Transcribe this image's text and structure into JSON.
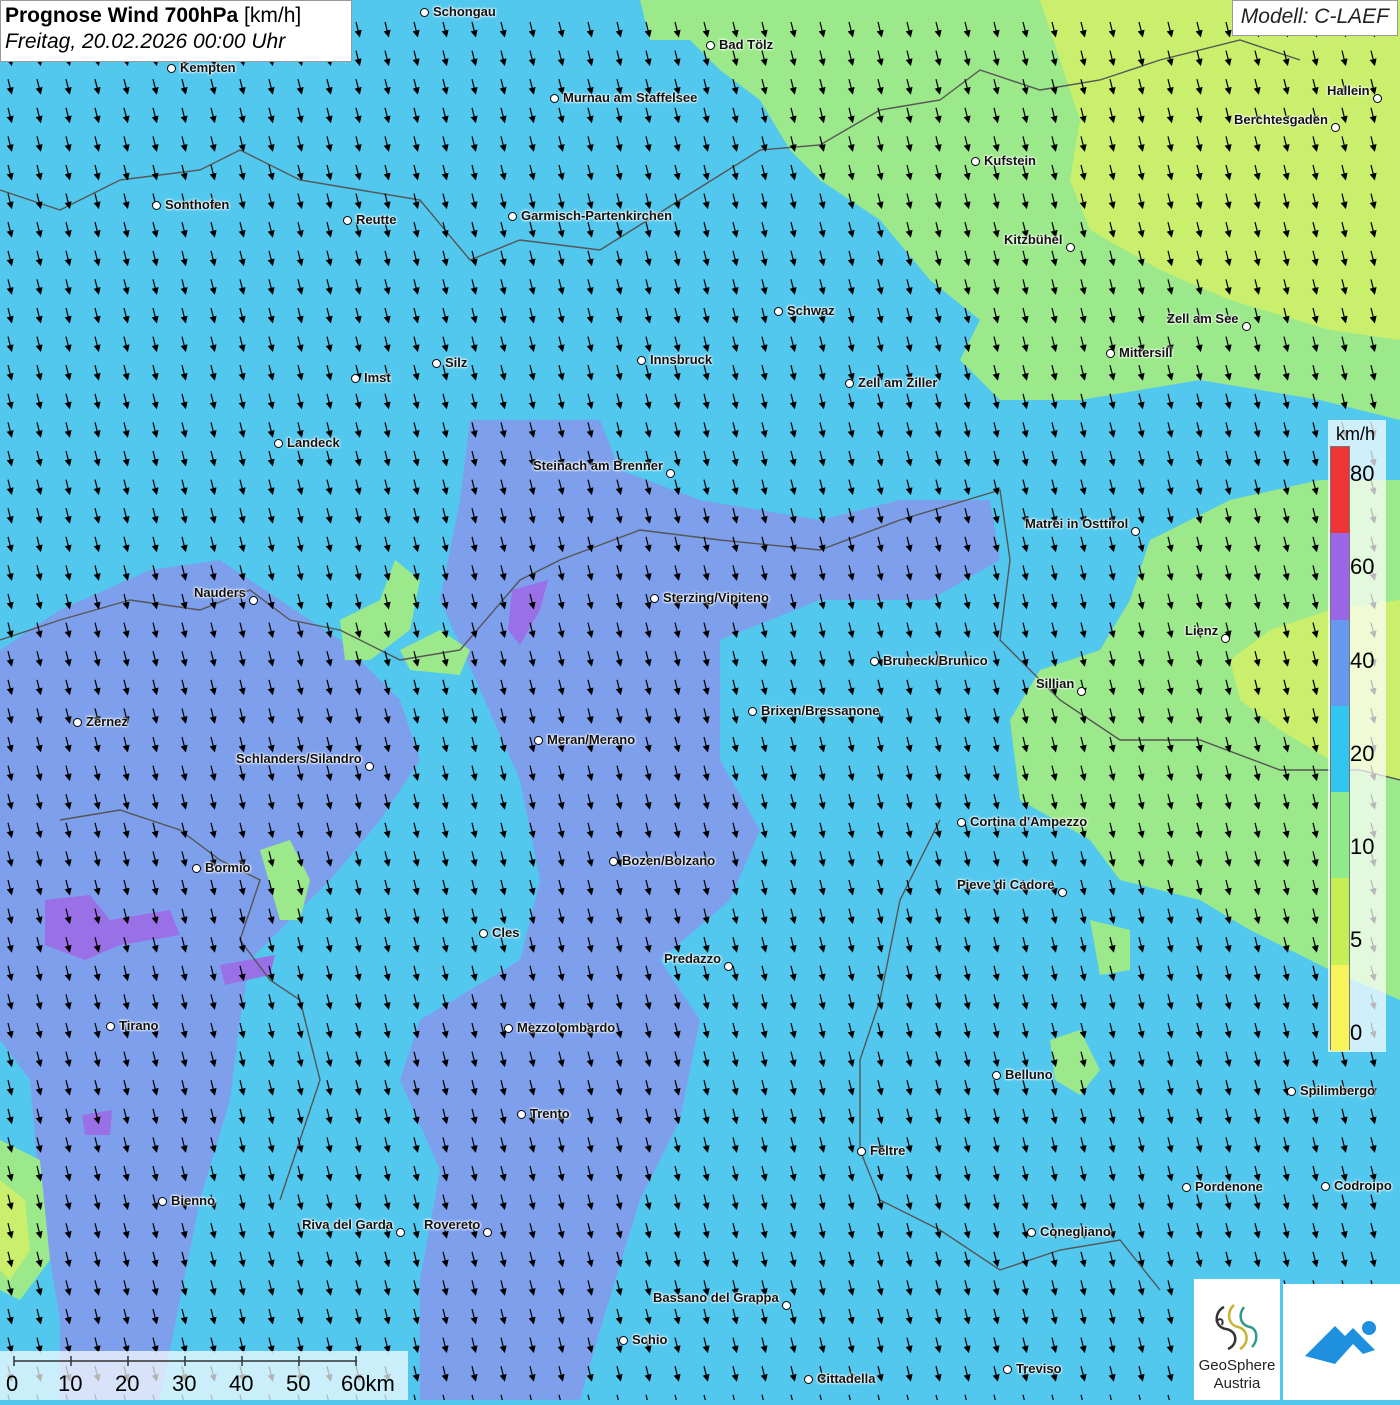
{
  "header": {
    "title_bold": "Prognose Wind 700hPa",
    "title_unit": " [km/h]",
    "datetime": "Freitag, 20.02.2026 00:00 Uhr",
    "model": "Modell: C-LAEF"
  },
  "legend": {
    "unit": "km/h",
    "ticks": [
      "0",
      "5",
      "10",
      "20",
      "40",
      "60",
      "80"
    ],
    "colors": [
      "#f7f35a",
      "#c4ef56",
      "#8eec8a",
      "#31c6ef",
      "#6699ee",
      "#9a66e6",
      "#ee3434"
    ]
  },
  "scale_bar": {
    "labels": [
      "0",
      "10",
      "20",
      "30",
      "40",
      "50",
      "60km"
    ]
  },
  "map_colors": {
    "wind_20_40": "#52c8ee",
    "wind_40_60": "#7ea0ec",
    "wind_60_80": "#9a70e6",
    "wind_10_20": "#9be98a",
    "wind_5_10": "#c9ef6c",
    "border": "#555555",
    "arrow": "#000000"
  },
  "wind_arrow_direction": "south-southeast",
  "cities": [
    {
      "name": "Schongau"
    },
    {
      "name": "Bad Tölz"
    },
    {
      "name": "Kempten"
    },
    {
      "name": "Murnau am Staffelsee"
    },
    {
      "name": "Hallein"
    },
    {
      "name": "Berchtesgaden"
    },
    {
      "name": "Kufstein"
    },
    {
      "name": "Sonthofen"
    },
    {
      "name": "Reutte"
    },
    {
      "name": "Garmisch-Partenkirchen"
    },
    {
      "name": "Kitzbühel"
    },
    {
      "name": "Schwaz"
    },
    {
      "name": "Zell am See"
    },
    {
      "name": "Innsbruck"
    },
    {
      "name": "Silz"
    },
    {
      "name": "Mittersill"
    },
    {
      "name": "Imst"
    },
    {
      "name": "Zell am Ziller"
    },
    {
      "name": "Landeck"
    },
    {
      "name": "Steinach am Brenner"
    },
    {
      "name": "Matrei in Osttirol"
    },
    {
      "name": "Nauders"
    },
    {
      "name": "Sterzing/Vipiteno"
    },
    {
      "name": "Lienz"
    },
    {
      "name": "Bruneck/Brunico"
    },
    {
      "name": "Sillian"
    },
    {
      "name": "Brixen/Bressanone"
    },
    {
      "name": "Zernez"
    },
    {
      "name": "Meran/Merano"
    },
    {
      "name": "Schlanders/Silandro"
    },
    {
      "name": "Cortina d'Ampezzo"
    },
    {
      "name": "Bozen/Bolzano"
    },
    {
      "name": "Bormio"
    },
    {
      "name": "Pieve di Cadore"
    },
    {
      "name": "Cles"
    },
    {
      "name": "Predazzo"
    },
    {
      "name": "Tirano"
    },
    {
      "name": "Mezzolombardo"
    },
    {
      "name": "Belluno"
    },
    {
      "name": "Spilimbergo"
    },
    {
      "name": "Trento"
    },
    {
      "name": "Feltre"
    },
    {
      "name": "Pordenone"
    },
    {
      "name": "Codroipo"
    },
    {
      "name": "Bienno"
    },
    {
      "name": "Riva del Garda"
    },
    {
      "name": "Rovereto"
    },
    {
      "name": "Conegliano"
    },
    {
      "name": "Bassano del Grappa"
    },
    {
      "name": "Schio"
    },
    {
      "name": "Treviso"
    },
    {
      "name": "Cittadella"
    }
  ],
  "logos": {
    "geosphere_line1": "GeoSphere",
    "geosphere_line2": "Austria"
  }
}
